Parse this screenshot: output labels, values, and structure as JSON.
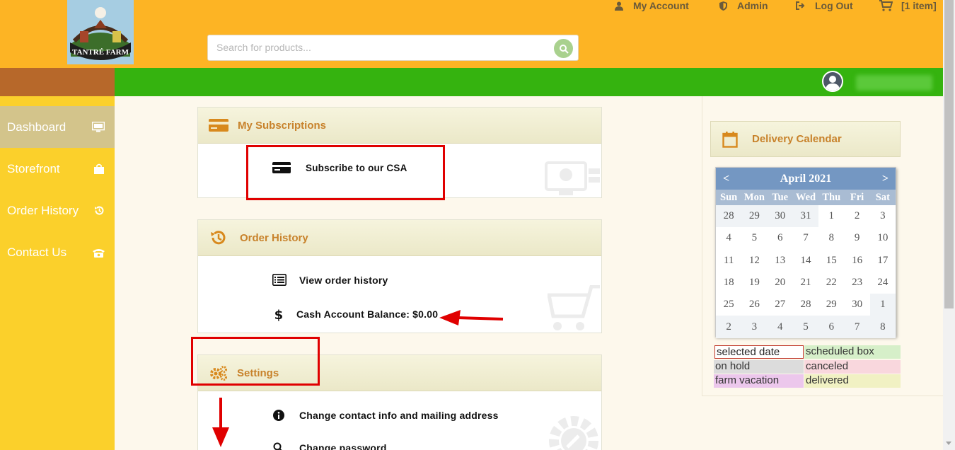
{
  "header": {
    "logo_text": "TANTRÉ FARM",
    "search_placeholder": "Search for products...",
    "nav": {
      "my_account": "My Account",
      "admin": "Admin",
      "logout": "Log Out",
      "cart": "[1 item]"
    }
  },
  "sidebar": {
    "items": [
      {
        "label": "Dashboard"
      },
      {
        "label": "Storefront"
      },
      {
        "label": "Order History"
      },
      {
        "label": "Contact Us"
      }
    ]
  },
  "subscriptions": {
    "title": "My Subscriptions",
    "subscribe": "Subscribe to our CSA"
  },
  "order_history": {
    "title": "Order History",
    "view": "View order history",
    "balance": "Cash Account Balance: $0.00"
  },
  "settings": {
    "title": "Settings",
    "contact": "Change contact info and mailing address",
    "password": "Change password"
  },
  "calendar": {
    "title": "Delivery Calendar",
    "month": "April 2021",
    "prev": "<",
    "next": ">",
    "dow": [
      "Sun",
      "Mon",
      "Tue",
      "Wed",
      "Thu",
      "Fri",
      "Sat"
    ],
    "weeks": [
      [
        "28",
        "29",
        "30",
        "31",
        "1",
        "2",
        "3"
      ],
      [
        "4",
        "5",
        "6",
        "7",
        "8",
        "9",
        "10"
      ],
      [
        "11",
        "12",
        "13",
        "14",
        "15",
        "16",
        "17"
      ],
      [
        "18",
        "19",
        "20",
        "21",
        "22",
        "23",
        "24"
      ],
      [
        "25",
        "26",
        "27",
        "28",
        "29",
        "30",
        "1"
      ],
      [
        "2",
        "3",
        "4",
        "5",
        "6",
        "7",
        "8"
      ]
    ],
    "legend": {
      "selected": "selected date",
      "scheduled": "scheduled box",
      "hold": "on hold",
      "canceled": "canceled",
      "vacation": "farm vacation",
      "delivered": "delivered"
    }
  },
  "colors": {
    "header": "#fdb424",
    "sidebar": "#fbd02b",
    "greenbar": "#35b30f",
    "accent": "#c8822b",
    "annotation": "#e00000"
  }
}
